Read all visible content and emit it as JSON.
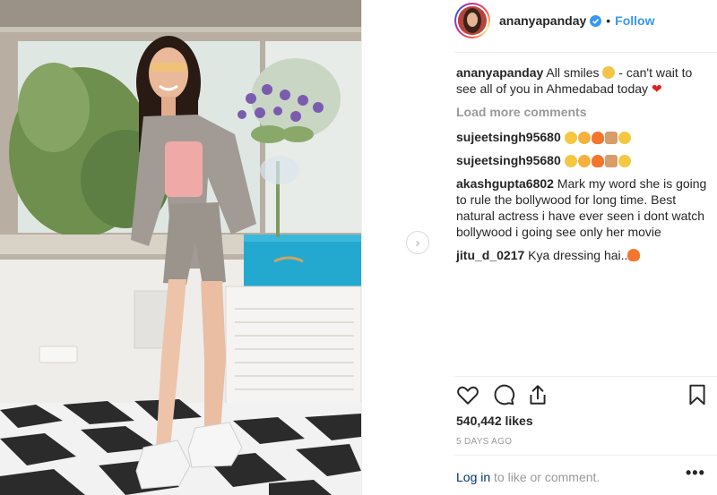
{
  "post": {
    "username": "ananyapanday",
    "follow_label": "Follow",
    "separator": "•",
    "caption_text": "All smiles",
    "caption_text_2": " - can't wait to see all of you in Ahmedabad today",
    "load_more": "Load more comments",
    "comments": [
      {
        "user": "sujeetsingh95680",
        "text": ""
      },
      {
        "user": "sujeetsingh95680",
        "text": ""
      },
      {
        "user": "akashgupta6802",
        "text": "Mark my word she is going to rule the bollywood for long time. Best natural actress i have ever seen i dont watch bollywood i going see only her movie"
      },
      {
        "user": "jitu_d_0217",
        "text": "Kya dressing hai.."
      }
    ],
    "likes": "540,442 likes",
    "time": "5 DAYS AGO",
    "login_link": "Log in",
    "login_rest": " to like or comment.",
    "more": "•••",
    "nav_arrow": "›"
  },
  "colors": {
    "link_blue": "#3897f0",
    "muted": "#999999",
    "text": "#262626",
    "border": "#efefef"
  },
  "icons": [
    "verified-badge-icon",
    "heart-icon",
    "comment-icon",
    "share-icon",
    "bookmark-icon",
    "chevron-right-icon",
    "more-options-icon"
  ]
}
